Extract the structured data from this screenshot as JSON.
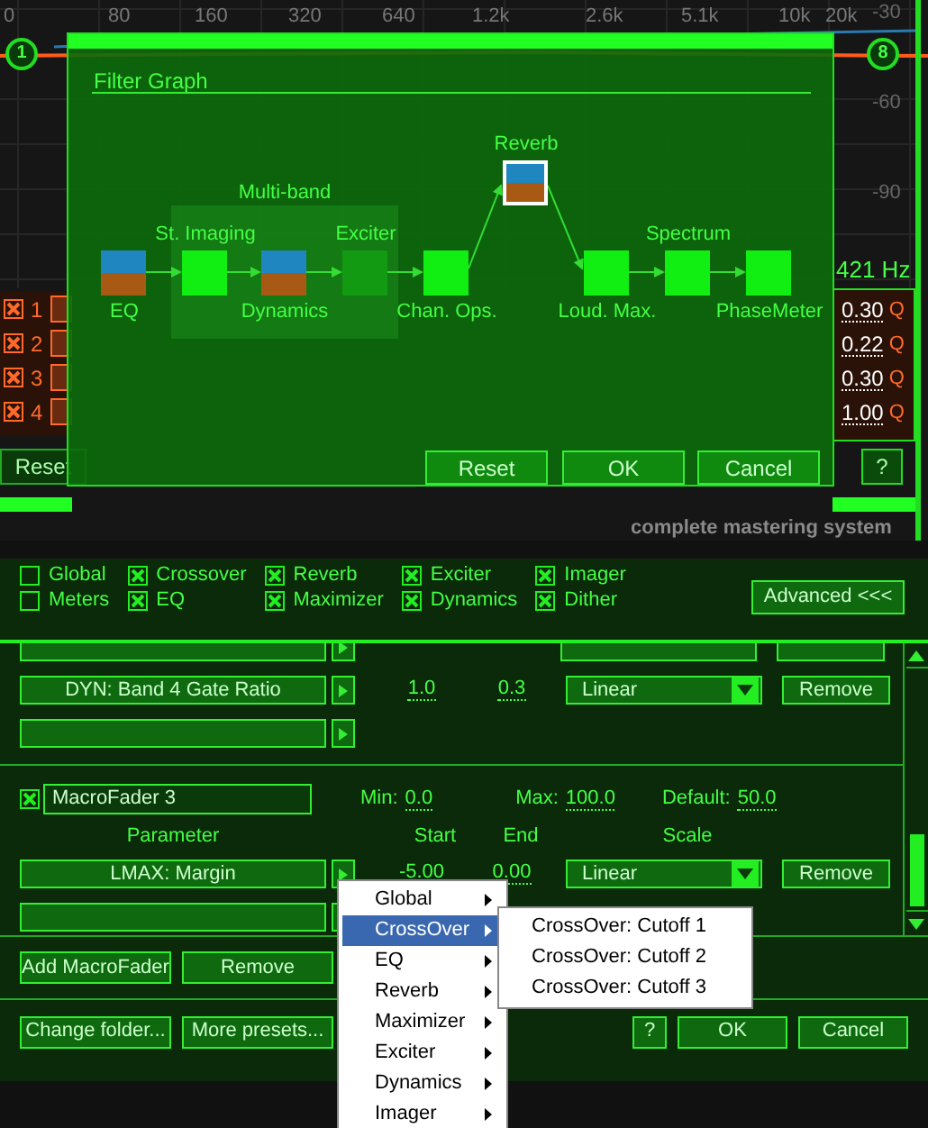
{
  "eq_display": {
    "freq_labels": [
      "0",
      "80",
      "160",
      "320",
      "640",
      "1.2k",
      "2.6k",
      "5.1k",
      "10k",
      "20k"
    ],
    "db_labels": [
      "-30",
      "-60",
      "-90"
    ],
    "band_markers": [
      "1",
      "8"
    ],
    "readout": "421 Hz",
    "bands": [
      {
        "number": "1",
        "enabled": true,
        "q": "0.30",
        "q_unit": "Q"
      },
      {
        "number": "2",
        "enabled": true,
        "q": "0.22",
        "q_unit": "Q"
      },
      {
        "number": "3",
        "enabled": true,
        "q": "0.30",
        "q_unit": "Q"
      },
      {
        "number": "4",
        "enabled": true,
        "q": "1.00",
        "q_unit": "Q"
      }
    ],
    "reset_button": "Reset",
    "help_button": "?",
    "tagline": "complete mastering system"
  },
  "filter_graph": {
    "title": "Filter Graph",
    "group_label": "Multi-band",
    "modules": [
      {
        "label": "EQ",
        "kind": "split",
        "selected": false
      },
      {
        "label": "St. Imaging",
        "kind": "solid",
        "selected": false
      },
      {
        "label": "Dynamics",
        "kind": "split",
        "selected": false
      },
      {
        "label": "Exciter",
        "kind": "dim",
        "selected": false
      },
      {
        "label": "Chan. Ops.",
        "kind": "solid",
        "selected": false
      },
      {
        "label": "Reverb",
        "kind": "split",
        "selected": true
      },
      {
        "label": "Loud. Max.",
        "kind": "solid",
        "selected": false
      },
      {
        "label": "Spectrum",
        "kind": "solid",
        "selected": false
      },
      {
        "label": "PhaseMeter",
        "kind": "solid",
        "selected": false
      }
    ],
    "buttons": [
      "Reset",
      "OK",
      "Cancel"
    ]
  },
  "components": [
    {
      "label": "Global",
      "checked": false
    },
    {
      "label": "Meters",
      "checked": false
    },
    {
      "label": "Crossover",
      "checked": true
    },
    {
      "label": "EQ",
      "checked": true
    },
    {
      "label": "Reverb",
      "checked": true
    },
    {
      "label": "Maximizer",
      "checked": true
    },
    {
      "label": "Exciter",
      "checked": true
    },
    {
      "label": "Dynamics",
      "checked": true
    },
    {
      "label": "Imager",
      "checked": true
    },
    {
      "label": "Dither",
      "checked": true
    }
  ],
  "advanced_button": "Advanced <<<",
  "macro_rows_above": [
    {
      "kind": "clipped"
    },
    {
      "kind": "param",
      "parameter": "DYN: Band 4 Gate Ratio",
      "start": "1.0",
      "end": "0.3",
      "scale": "Linear",
      "remove": "Remove"
    },
    {
      "kind": "empty"
    }
  ],
  "macrofader": {
    "enabled": true,
    "name": "MacroFader 3",
    "min_label": "Min:",
    "min": "0.0",
    "max_label": "Max:",
    "max": "100.0",
    "default_label": "Default:",
    "default": "50.0",
    "columns": [
      "Parameter",
      "Start",
      "End",
      "Scale"
    ],
    "rows": [
      {
        "kind": "param",
        "parameter": "LMAX: Margin",
        "start": "-5.00",
        "end": "0.00",
        "scale": "Linear",
        "remove": "Remove"
      },
      {
        "kind": "empty"
      }
    ]
  },
  "macro_buttons": [
    "Add MacroFader",
    "Remove"
  ],
  "footer_buttons": {
    "left": [
      "Change folder...",
      "More presets..."
    ],
    "help": "?",
    "ok": "OK",
    "cancel": "Cancel"
  },
  "context_menu": {
    "items": [
      {
        "label": "Global",
        "selected": false
      },
      {
        "label": "CrossOver",
        "selected": true
      },
      {
        "label": "EQ",
        "selected": false
      },
      {
        "label": "Reverb",
        "selected": false
      },
      {
        "label": "Maximizer",
        "selected": false
      },
      {
        "label": "Exciter",
        "selected": false
      },
      {
        "label": "Dynamics",
        "selected": false
      },
      {
        "label": "Imager",
        "selected": false
      }
    ],
    "submenu": [
      "CrossOver: Cutoff 1",
      "CrossOver: Cutoff 2",
      "CrossOver: Cutoff 3"
    ]
  }
}
